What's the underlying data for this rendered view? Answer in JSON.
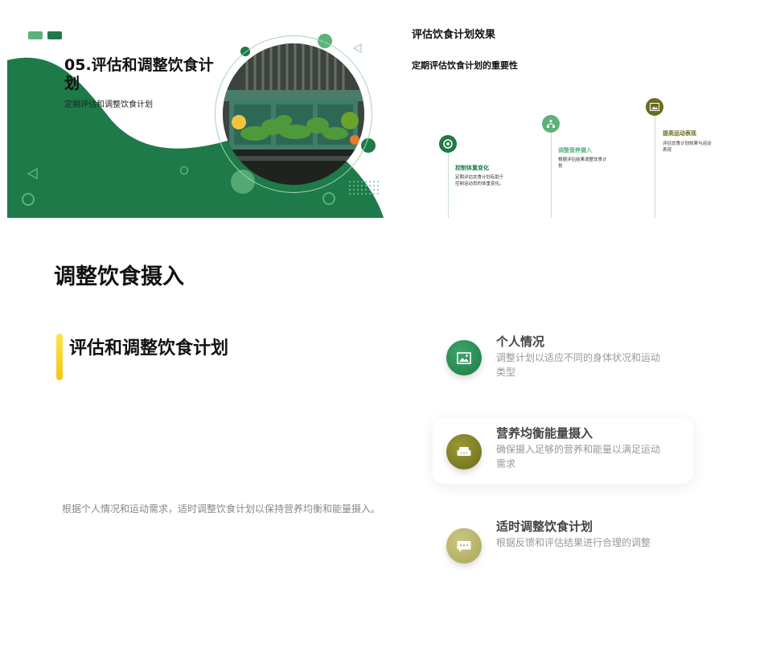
{
  "slide1": {
    "title": "05.评估和调整饮食计划",
    "subtitle": "定期评估和调整饮食计划",
    "colors": {
      "dark_green": "#1e7a49",
      "light_green": "#5cb27a"
    }
  },
  "slide2": {
    "title": "评估饮食计划效果",
    "subtitle": "定期评估饮食计划的重要性",
    "milestones": [
      {
        "heading": "控制体重变化",
        "text": "定期评估饮食计划有助于控制运动员的体重变化。",
        "icon": "target-icon",
        "color": "#1e7a49"
      },
      {
        "heading": "调整营养摄入",
        "text": "根据评估结果调整饮食计划",
        "icon": "sitemap-icon",
        "color": "#5cb27a"
      },
      {
        "heading": "提高运动表现",
        "text": "评估饮食计划效果与运动表现",
        "icon": "image-icon",
        "color": "#6b6b22"
      }
    ]
  },
  "slide3": {
    "title": "调整饮食摄入",
    "section_title": "评估和调整饮食计划",
    "description": "根据个人情况和运动需求，适时调整饮食计划以保持营养均衡和能量摄入。",
    "items": [
      {
        "heading": "个人情况",
        "text": "调整计划以适应不同的身体状况和运动类型",
        "icon": "image-icon",
        "color": "#1e7a49"
      },
      {
        "heading": "营养均衡能量摄入",
        "text": "确保摄入足够的营养和能量以满足运动需求",
        "icon": "sofa-icon",
        "color": "#7a7a1f"
      },
      {
        "heading": "适时调整饮食计划",
        "text": "根据反馈和评估结果进行合理的调整",
        "icon": "chat-icon",
        "color": "#b7b56a"
      }
    ]
  }
}
